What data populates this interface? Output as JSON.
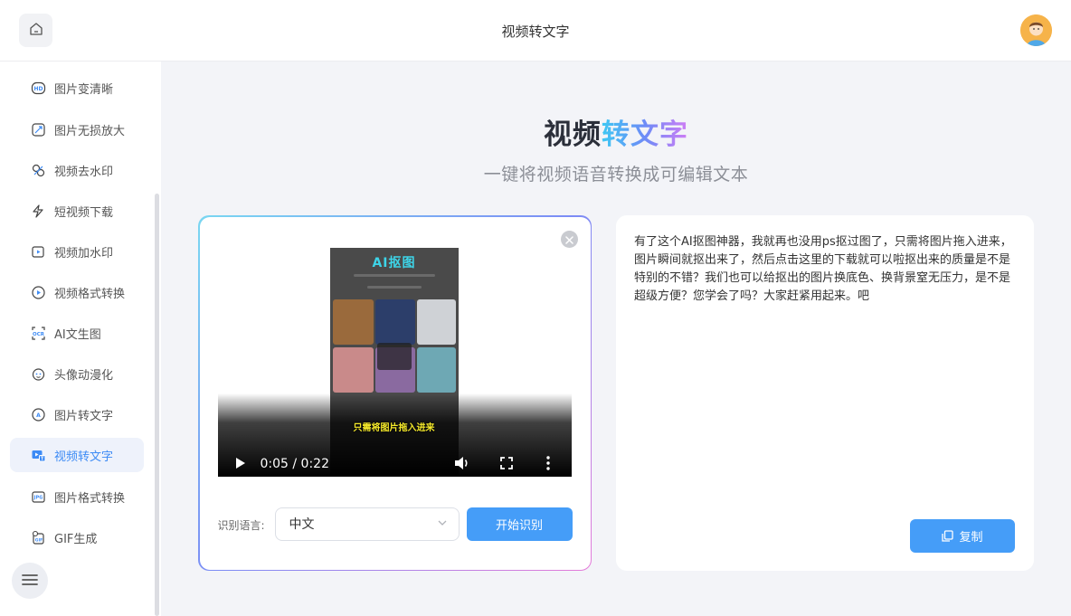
{
  "header": {
    "title": "视频转文字",
    "home_icon": "home-icon",
    "avatar_icon": "user-avatar"
  },
  "sidebar": {
    "items": [
      {
        "label": "图片变清晰",
        "icon": "hd-icon",
        "active": false
      },
      {
        "label": "图片无损放大",
        "icon": "enlarge-icon",
        "active": false
      },
      {
        "label": "视频去水印",
        "icon": "watermark-remove-icon",
        "active": false
      },
      {
        "label": "短视频下载",
        "icon": "download-link-icon",
        "active": false
      },
      {
        "label": "视频加水印",
        "icon": "watermark-add-icon",
        "active": false
      },
      {
        "label": "视频格式转换",
        "icon": "video-format-icon",
        "active": false
      },
      {
        "label": "AI文生图",
        "icon": "ai-image-icon",
        "active": false
      },
      {
        "label": "头像动漫化",
        "icon": "avatar-anime-icon",
        "active": false
      },
      {
        "label": "图片转文字",
        "icon": "image-to-text-icon",
        "active": false
      },
      {
        "label": "视频转文字",
        "icon": "video-to-text-icon",
        "active": true
      },
      {
        "label": "图片格式转换",
        "icon": "image-format-icon",
        "active": false
      },
      {
        "label": "GIF生成",
        "icon": "gif-icon",
        "active": false
      }
    ],
    "menu_icon": "menu-icon"
  },
  "main": {
    "title_part1": "视频",
    "title_part2": "转文字",
    "subtitle": "一键将视频语音转换成可编辑文本"
  },
  "video": {
    "frame_title": "AI抠图",
    "subtitle_text": "只需将图片拖入进来",
    "current_time": "0:05",
    "duration": "0:22",
    "time_display": "0:05 / 0:22",
    "progress": 0.27
  },
  "controls": {
    "language_label": "识别语言:",
    "language_value": "中文",
    "start_button": "开始识别"
  },
  "result": {
    "text": "有了这个AI抠图神器，我就再也没用ps抠过图了，只需将图片拖入进来，图片瞬间就抠出来了，然后点击这里的下载就可以啦抠出来的质量是不是特别的不错？我们也可以给抠出的图片换底色、换背景窒无压力，是不是超级方便？您学会了吗？大家赶紧用起来。吧",
    "copy_button": "复制"
  },
  "colors": {
    "accent": "#459df8",
    "active_bg": "#eef2fb",
    "page_bg": "#f3f4f8"
  }
}
